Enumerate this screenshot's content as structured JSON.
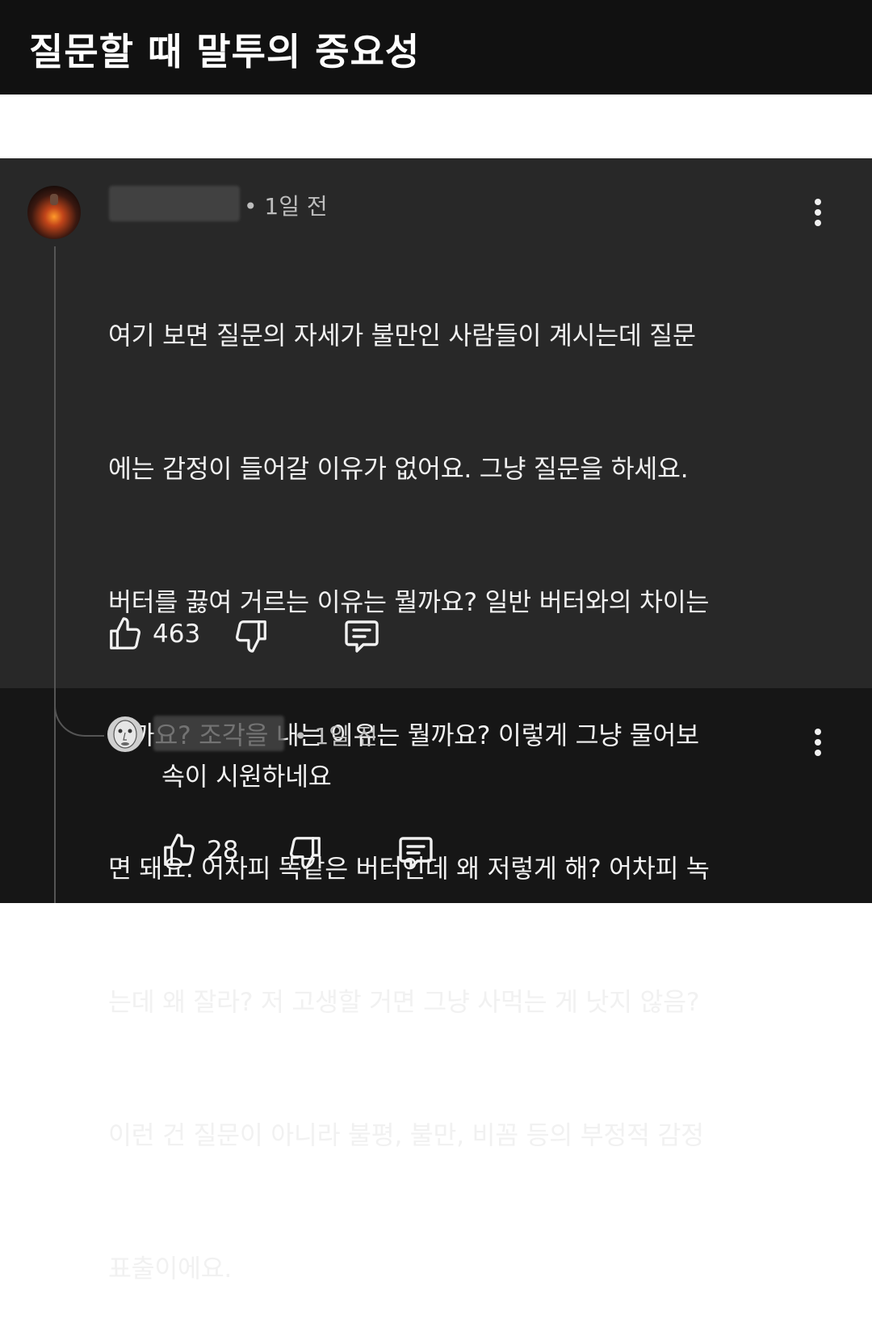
{
  "post": {
    "title": "질문할 때 말투의 중요성"
  },
  "comment": {
    "time": "• 1일 전",
    "text_lines": [
      "여기 보면 질문의 자세가 불만인 사람들이 계시는데 질문",
      "에는 감정이 들어갈 이유가 없어요. 그냥 질문을 하세요.",
      "버터를 끓여 거르는 이유는 뭘까요? 일반 버터와의 차이는",
      "뭘까요? 조각을 내는 이유는 뭘까요? 이렇게 그냥 물어보",
      "면 돼요. 어차피 똑같은 버터인데 왜 저렇게 해? 어차피 녹",
      "는데 왜 잘라? 저 고생할 거면 그냥 사먹는 게 낫지 않음?",
      "이런 건 질문이 아니라 불평, 불만, 비꼼 등의 부정적 감정",
      "표출이에요."
    ],
    "like_count": "463"
  },
  "reply": {
    "time": "• 1일 전",
    "text": "속이 시원하네요",
    "like_count": "28"
  },
  "colors": {
    "header_bg": "#111111",
    "comment_bg": "#282828",
    "reply_bg": "#161616",
    "text": "#f1f1f1",
    "meta": "#bdbdbd"
  },
  "icons": [
    "thumbs-up-icon",
    "thumbs-down-icon",
    "reply-icon",
    "more-vertical-icon"
  ]
}
